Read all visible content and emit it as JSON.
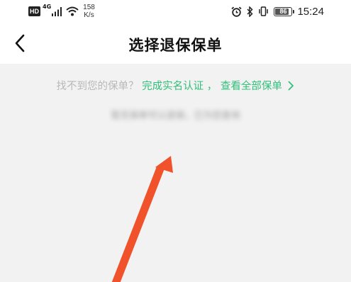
{
  "status_bar": {
    "hd_label": "HD",
    "network_type": "4G",
    "net_speed_value": "158",
    "net_speed_unit": "K/s",
    "battery_level": "86",
    "battery_percent": 86,
    "time": "15:24",
    "icons": [
      "signal-icon",
      "wifi-icon",
      "alarm-icon",
      "bluetooth-icon",
      "vibrate-icon",
      "battery-icon"
    ]
  },
  "header": {
    "title": "选择退保保单",
    "back_icon": "chevron-left-icon"
  },
  "main": {
    "notice_prefix": "找不到您的保单？",
    "verify_link": "完成实名认证",
    "separator": "，",
    "view_all_link": "查看全部保单",
    "link_icon": "chevron-right-icon",
    "link_color": "#31c07a",
    "blurred_note": "暂无保单可以退保，已为您查询"
  },
  "annotation": {
    "arrow_color": "#f0522b"
  }
}
